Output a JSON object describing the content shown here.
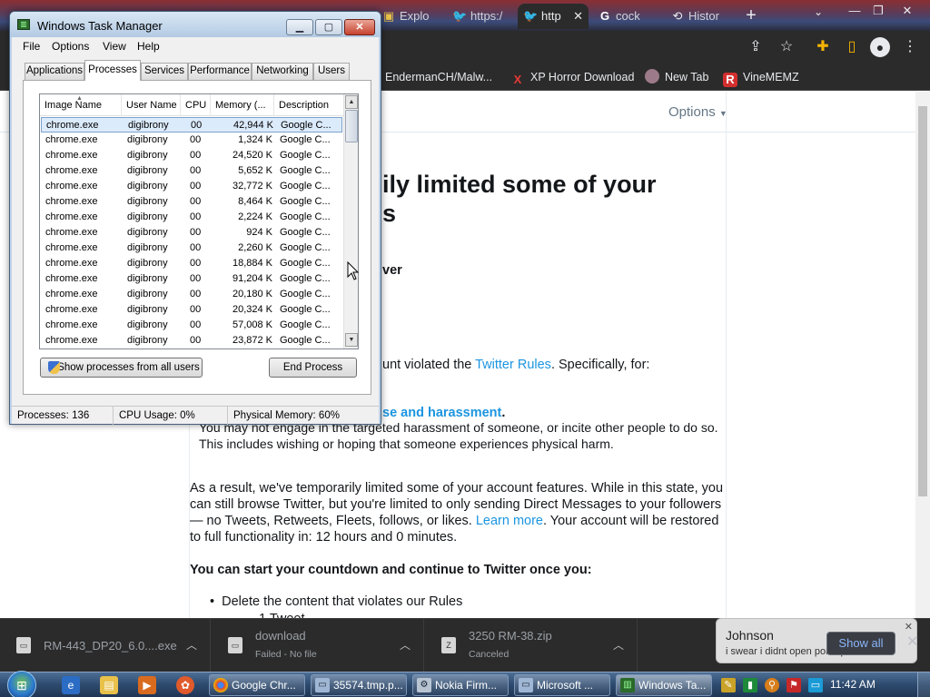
{
  "browser": {
    "tabs": [
      {
        "label": "Explo",
        "icon": "explorer-icon"
      },
      {
        "label": "https:/",
        "icon": "twitter-bird-icon"
      },
      {
        "label": "http",
        "icon": "twitter-bird-icon",
        "active": true
      },
      {
        "label": "cock",
        "icon": "google-g-icon"
      },
      {
        "label": "Histor",
        "icon": "history-icon"
      }
    ],
    "bookmarks": [
      {
        "label": "EndermanCH/Malw...",
        "icon": "github-icon"
      },
      {
        "label": "XP Horror Download",
        "icon": "x-red-icon"
      },
      {
        "label": "New Tab",
        "icon": "new-tab-icon"
      },
      {
        "label": "VineMEMZ",
        "icon": "r-red-icon"
      }
    ]
  },
  "twitter_page": {
    "options_label": "Options",
    "heading_line1": "ily limited some of your",
    "heading_line2": "s",
    "partial_bold": "ver",
    "violation_text": "unt violated the ",
    "rules_link": "Twitter Rules",
    "violation_tail": ". Specifically, for:",
    "category_link": "se and harassment",
    "category_dot": ".",
    "category_desc": "You may not engage in the targeted harassment of someone, or incite other people to do so. This includes wishing or hoping that someone experiences physical harm.",
    "result_text_a": "As a result, we've temporarily limited some of your account features. While in this state, you can still browse Twitter, but you're limited to only sending Direct Messages to your followers — no Tweets, Retweets, Fleets, follows, or likes. ",
    "learn_more": "Learn more",
    "result_text_b": ". Your account will be restored to full functionality in: 12 hours and 0 minutes.",
    "countdown_heading": "You can start your countdown and continue to Twitter once you:",
    "bullet_1": "Delete the content that violates our Rules",
    "sub_bullet": "1 Tweet"
  },
  "downloads": [
    {
      "name": "RM-443_DP20_6.0....exe",
      "status": ""
    },
    {
      "name": "download",
      "status": "Failed - No file"
    },
    {
      "name": "3250 RM-38.zip",
      "status": "Canceled"
    }
  ],
  "download_show_all": "Show all",
  "notification": {
    "name": "Johnson",
    "message": "i swear i didnt open porn quize i swear"
  },
  "taskmgr": {
    "title": "Windows Task Manager",
    "menus": [
      "File",
      "Options",
      "View",
      "Help"
    ],
    "tabs": [
      "Applications",
      "Processes",
      "Services",
      "Performance",
      "Networking",
      "Users"
    ],
    "active_tab": "Processes",
    "columns": [
      "Image Name",
      "User Name",
      "CPU",
      "Memory (...",
      "Description"
    ],
    "rows": [
      {
        "image": "chrome.exe",
        "user": "digibrony",
        "cpu": "00",
        "mem": "42,944 K",
        "desc": "Google C..."
      },
      {
        "image": "chrome.exe",
        "user": "digibrony",
        "cpu": "00",
        "mem": "1,324 K",
        "desc": "Google C..."
      },
      {
        "image": "chrome.exe",
        "user": "digibrony",
        "cpu": "00",
        "mem": "24,520 K",
        "desc": "Google C..."
      },
      {
        "image": "chrome.exe",
        "user": "digibrony",
        "cpu": "00",
        "mem": "5,652 K",
        "desc": "Google C..."
      },
      {
        "image": "chrome.exe",
        "user": "digibrony",
        "cpu": "00",
        "mem": "32,772 K",
        "desc": "Google C..."
      },
      {
        "image": "chrome.exe",
        "user": "digibrony",
        "cpu": "00",
        "mem": "8,464 K",
        "desc": "Google C..."
      },
      {
        "image": "chrome.exe",
        "user": "digibrony",
        "cpu": "00",
        "mem": "2,224 K",
        "desc": "Google C..."
      },
      {
        "image": "chrome.exe",
        "user": "digibrony",
        "cpu": "00",
        "mem": "924 K",
        "desc": "Google C..."
      },
      {
        "image": "chrome.exe",
        "user": "digibrony",
        "cpu": "00",
        "mem": "2,260 K",
        "desc": "Google C..."
      },
      {
        "image": "chrome.exe",
        "user": "digibrony",
        "cpu": "00",
        "mem": "18,884 K",
        "desc": "Google C..."
      },
      {
        "image": "chrome.exe",
        "user": "digibrony",
        "cpu": "00",
        "mem": "91,204 K",
        "desc": "Google C..."
      },
      {
        "image": "chrome.exe",
        "user": "digibrony",
        "cpu": "00",
        "mem": "20,180 K",
        "desc": "Google C..."
      },
      {
        "image": "chrome.exe",
        "user": "digibrony",
        "cpu": "00",
        "mem": "20,324 K",
        "desc": "Google C..."
      },
      {
        "image": "chrome.exe",
        "user": "digibrony",
        "cpu": "00",
        "mem": "57,008 K",
        "desc": "Google C..."
      },
      {
        "image": "chrome.exe",
        "user": "digibrony",
        "cpu": "00",
        "mem": "23,872 K",
        "desc": "Google C..."
      }
    ],
    "show_all_button": "Show processes from all users",
    "end_process_button": "End Process",
    "status": {
      "processes": "Processes: 136",
      "cpu": "CPU Usage: 0%",
      "memory": "Physical Memory: 60%"
    }
  },
  "taskbar": {
    "buttons": [
      {
        "label": "Google Chr...",
        "icon": "chrome-icon"
      },
      {
        "label": "35574.tmp.p...",
        "icon": "window-icon"
      },
      {
        "label": "Nokia Firm...",
        "icon": "nokia-icon"
      },
      {
        "label": "Microsoft ...",
        "icon": "window-icon"
      },
      {
        "label": "Windows Ta...",
        "icon": "taskmgr-icon",
        "active": true
      }
    ],
    "clock": "11:42 AM"
  }
}
